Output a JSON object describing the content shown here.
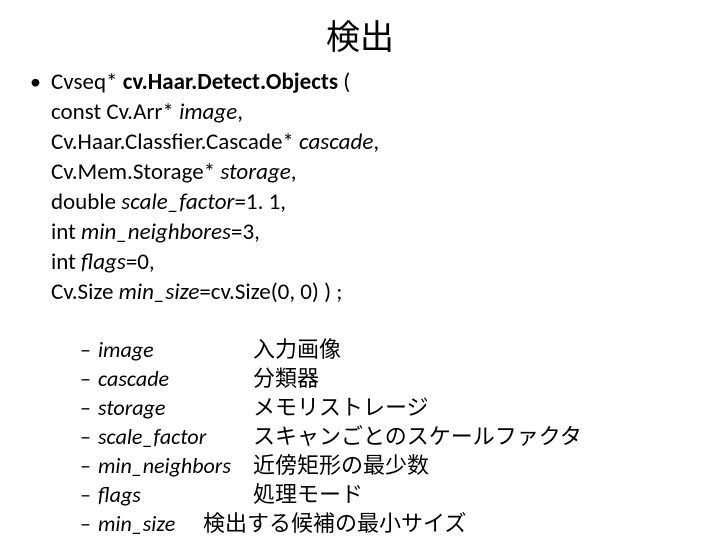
{
  "title": "検出",
  "bullet_dot": "•",
  "signature": {
    "line1_a": "Cvseq* ",
    "line1_b": "cv.Haar.Detect.Objects",
    "line1_c": " (",
    "line2_a": "const Cv.Arr* ",
    "line2_b": "image",
    "line2_c": ",",
    "line3_a": "Cv.Haar.Classfier.Cascade* ",
    "line3_b": "cascade",
    "line3_c": ",",
    "line4_a": "Cv.Mem.Storage* ",
    "line4_b": "storage",
    "line4_c": ",",
    "line5_a": "double ",
    "line5_b": "scale_factor",
    "line5_c": "=1. 1,",
    "line6_a": "int ",
    "line6_b": "min_neighbores",
    "line6_c": "=3,",
    "line7_a": "int ",
    "line7_b": "flags",
    "line7_c": "=0,",
    "line8_a": "Cv.Size ",
    "line8_b": "min_size",
    "line8_c": "=cv.Size(0, 0) ) ;"
  },
  "dash": "–",
  "params": [
    {
      "name": "image",
      "desc": "入力画像"
    },
    {
      "name": "cascade",
      "desc": "分類器"
    },
    {
      "name": "storage",
      "desc": "メモリストレージ"
    },
    {
      "name": "scale_factor",
      "desc": "スキャンごとのスケールファクタ"
    },
    {
      "name": "min_neighbors",
      "desc": "近傍矩形の最少数"
    },
    {
      "name": "flags",
      "desc": "処理モード"
    },
    {
      "name": "min_size",
      "desc": "検出する候補の最小サイズ"
    }
  ],
  "param_name_width": 150,
  "last_param_name_width": 100
}
